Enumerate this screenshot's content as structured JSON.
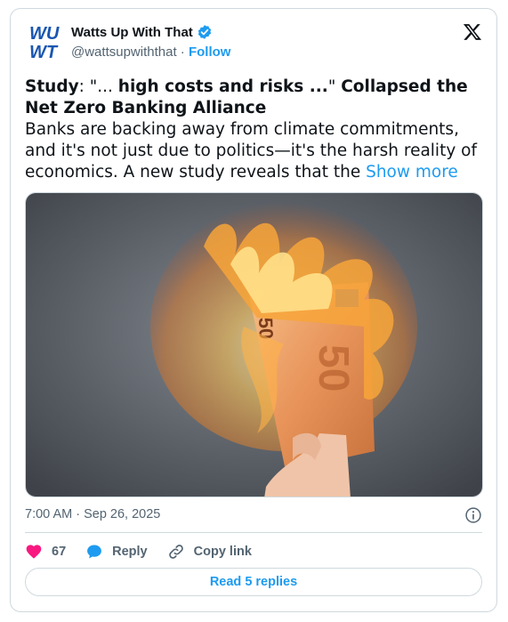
{
  "author": {
    "logo_text_top": "WU",
    "logo_text_bottom": "WT",
    "name": "Watts Up With That",
    "handle": "@wattsupwiththat",
    "separator": "·",
    "follow_label": "Follow",
    "verified_icon": "verified-badge-icon"
  },
  "tweet": {
    "bold_lead": "Study",
    "text_after_lead": ": \"... ",
    "bold_quote": "high costs and risks ...",
    "text_mid": "\" ",
    "bold_title": "Collapsed the Net Zero Banking Alliance",
    "body": "Banks are backing away from climate commitments, and it's not just due to politics—it's the harsh reality of economics. A new study reveals that the ",
    "show_more": "Show more"
  },
  "meta": {
    "timestamp": "7:00 AM · Sep 26, 2025"
  },
  "actions": {
    "like_count": "67",
    "reply_label": "Reply",
    "copy_label": "Copy link",
    "read_replies_label": "Read 5 replies"
  },
  "colors": {
    "accent": "#1d9bf0",
    "like": "#f91880",
    "logo_blue": "#1a56b0"
  }
}
